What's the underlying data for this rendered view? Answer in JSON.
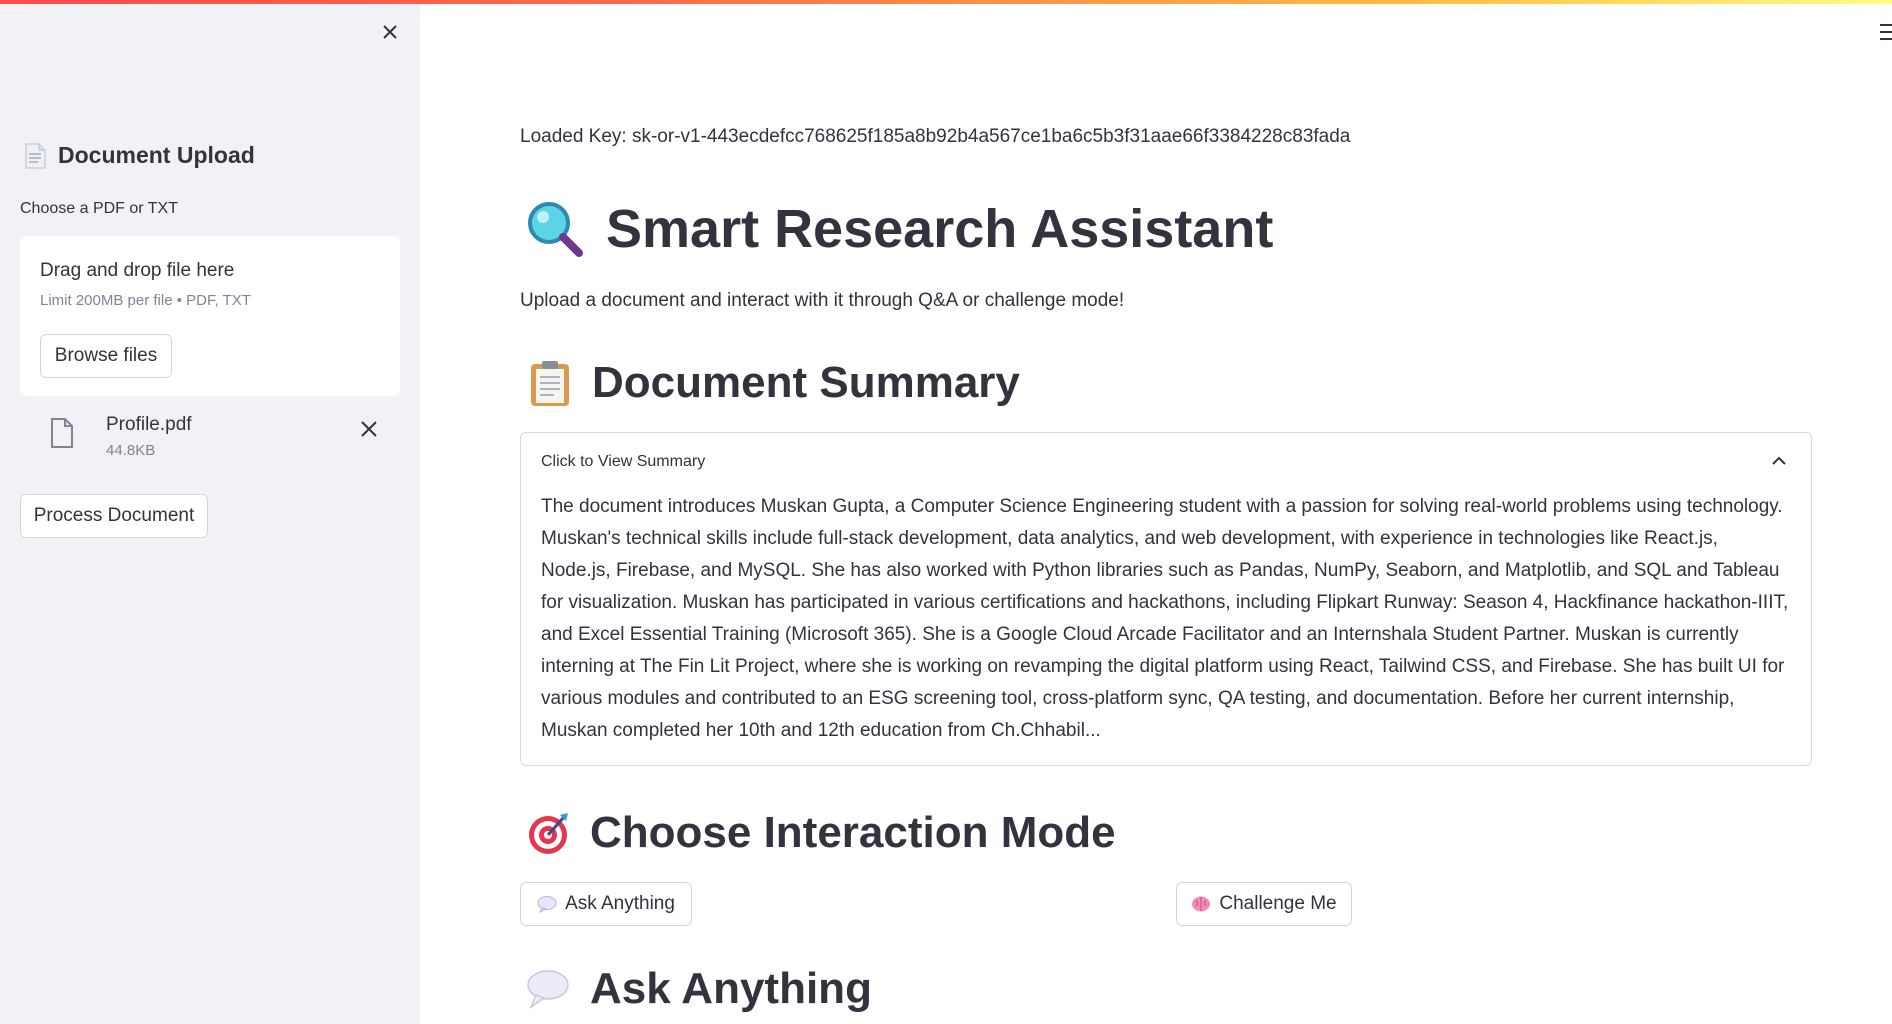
{
  "sidebar": {
    "title": "Document Upload",
    "upload_label": "Choose a PDF or TXT",
    "dropzone": {
      "instruction": "Drag and drop file here",
      "limit": "Limit 200MB per file • PDF, TXT",
      "browse_label": "Browse files"
    },
    "file": {
      "name": "Profile.pdf",
      "size": "44.8KB"
    },
    "process_label": "Process Document"
  },
  "main": {
    "loaded_key": "Loaded Key: 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",
    "title": "Smart Research Assistant",
    "subtitle": "Upload a document and interact with it through Q&A or challenge mode!",
    "summary_heading": "Document Summary",
    "summary_expander": {
      "label": "Click to View Summary",
      "text": "The document introduces Muskan Gupta, a Computer Science Engineering student with a passion for solving real-world problems using technology. Muskan's technical skills include full-stack development, data analytics, and web development, with experience in technologies like React.js, Node.js, Firebase, and MySQL. She has also worked with Python libraries such as Pandas, NumPy, Seaborn, and Matplotlib, and SQL and Tableau for visualization. Muskan has participated in various certifications and hackathons, including Flipkart Runway: Season 4, Hackfinance hackathon-IIIT, and Excel Essential Training (Microsoft 365). She is a Google Cloud Arcade Facilitator and an Internshala Student Partner. Muskan is currently interning at The Fin Lit Project, where she is working on revamping the digital platform using React, Tailwind CSS, and Firebase. She has built UI for various modules and contributed to an ESG screening tool, cross-platform sync, QA testing, and documentation. Before her current internship, Muskan completed her 10th and 12th education from Ch.Chhabil..."
    },
    "mode_heading": "Choose Interaction Mode",
    "ask_button_label": "Ask Anything",
    "challenge_button_label": "Challenge Me",
    "ask_heading": "Ask Anything"
  },
  "icons": {
    "close": "close-icon",
    "document": "document-icon",
    "file": "file-icon",
    "magnifier": "magnifying-glass-icon",
    "clipboard": "clipboard-icon",
    "target": "target-icon",
    "speech": "speech-bubble-icon",
    "brain": "brain-icon",
    "chevron": "chevron-up-icon",
    "menu": "menu-icon"
  },
  "colors": {
    "sidebar_bg": "#f0f2f6",
    "accent_red": "#ff4b4b",
    "text": "#31333F",
    "muted": "#808495"
  }
}
